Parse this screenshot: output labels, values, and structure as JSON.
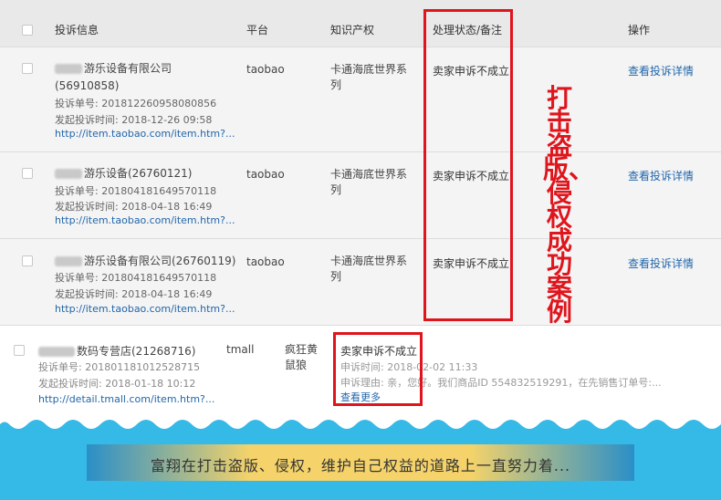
{
  "header": {
    "col_info": "投诉信息",
    "col_platform": "平台",
    "col_ip": "知识产权",
    "col_status": "处理状态/备注",
    "col_action": "操作"
  },
  "rows": [
    {
      "shop_name": "游乐设备有限公司",
      "shop_id": "(56910858)",
      "complaint_no": "投诉单号: 201812260958080856",
      "complaint_time": "发起投诉时间: 2018-12-26 09:58",
      "link": "http://item.taobao.com/item.htm?...",
      "platform": "taobao",
      "ip": "卡通海底世界系列",
      "status": "卖家申诉不成立",
      "action": "查看投诉详情"
    },
    {
      "shop_name": "游乐设备(26760121)",
      "complaint_no": "投诉单号: 201804181649570118",
      "complaint_time": "发起投诉时间: 2018-04-18 16:49",
      "link": "http://item.taobao.com/item.htm?...",
      "platform": "taobao",
      "ip": "卡通海底世界系列",
      "status": "卖家申诉不成立",
      "action": "查看投诉详情"
    },
    {
      "shop_name": "游乐设备有限公司(26760119)",
      "complaint_no": "投诉单号: 201804181649570118",
      "complaint_time": "发起投诉时间: 2018-04-18 16:49",
      "link": "http://item.taobao.com/item.htm?...",
      "platform": "taobao",
      "ip": "卡通海底世界系列",
      "status": "卖家申诉不成立",
      "action": "查看投诉详情"
    }
  ],
  "row4": {
    "shop_name": "数码专营店(21268716)",
    "complaint_no": "投诉单号: 201801181012528715",
    "complaint_time": "发起投诉时间: 2018-01-18 10:12",
    "link": "http://detail.tmall.com/item.htm?...",
    "platform": "tmall",
    "ip": "疯狂黄鼠狼",
    "status": "卖家申诉不成立",
    "appeal_time": "申诉时间: 2018-02-02 11:33",
    "appeal_reason": "申诉理由: 亲，您好。我们商品ID 554832519291，在先销售订单号:...",
    "more": "查看更多"
  },
  "annotation": "打击盗版、侵权成功案例",
  "slogan": "富翔在打击盗版、侵权，维护自己权益的道路上一直努力着...",
  "colors": {
    "accent_red": "#e0141c",
    "link_blue": "#2266aa",
    "band_blue": "#35b9e6",
    "slogan_gold": "#f5d36a"
  }
}
